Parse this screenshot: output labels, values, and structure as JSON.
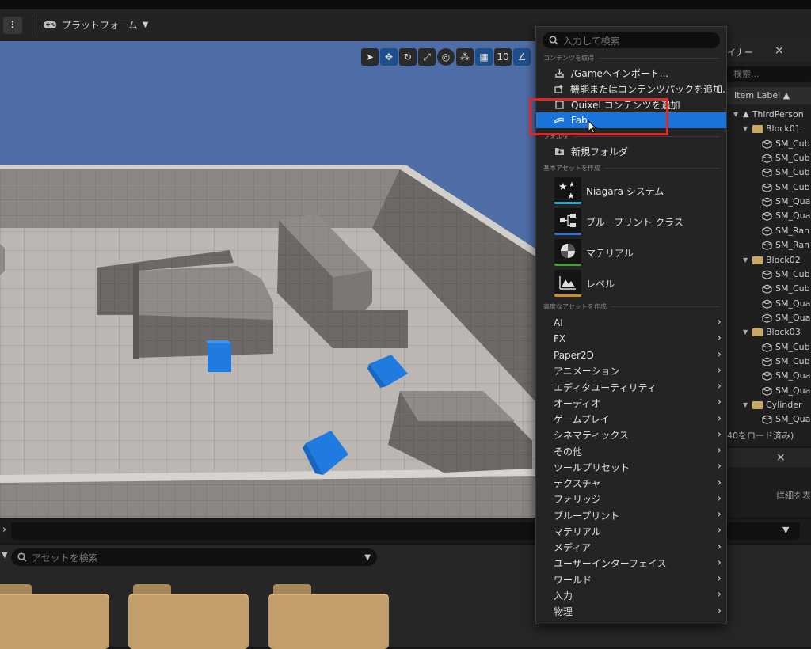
{
  "toolbar": {
    "platform_label": "プラットフォーム",
    "kebab": "⋮"
  },
  "viewport": {
    "grid_value": "10"
  },
  "outliner": {
    "tab_label": "イナー",
    "close": "×",
    "search_placeholder": "検索...",
    "column_header": "Item Label ▲",
    "rows": [
      {
        "label": "ThirdPerson",
        "kind": "level",
        "depth": 0
      },
      {
        "label": "Block01",
        "kind": "folder",
        "depth": 1
      },
      {
        "label": "SM_Cub",
        "kind": "mesh",
        "depth": 2
      },
      {
        "label": "SM_Cub",
        "kind": "mesh",
        "depth": 2
      },
      {
        "label": "SM_Cub",
        "kind": "mesh",
        "depth": 2
      },
      {
        "label": "SM_Cub",
        "kind": "mesh",
        "depth": 2
      },
      {
        "label": "SM_Qua",
        "kind": "mesh",
        "depth": 2
      },
      {
        "label": "SM_Qua",
        "kind": "mesh",
        "depth": 2
      },
      {
        "label": "SM_Ran",
        "kind": "mesh",
        "depth": 2
      },
      {
        "label": "SM_Ran",
        "kind": "mesh",
        "depth": 2
      },
      {
        "label": "Block02",
        "kind": "folder",
        "depth": 1
      },
      {
        "label": "SM_Cub",
        "kind": "mesh",
        "depth": 2
      },
      {
        "label": "SM_Cub",
        "kind": "mesh",
        "depth": 2
      },
      {
        "label": "SM_Qua",
        "kind": "mesh",
        "depth": 2
      },
      {
        "label": "SM_Qua",
        "kind": "mesh",
        "depth": 2
      },
      {
        "label": "Block03",
        "kind": "folder",
        "depth": 1
      },
      {
        "label": "SM_Cub",
        "kind": "mesh",
        "depth": 2
      },
      {
        "label": "SM_Cub",
        "kind": "mesh",
        "depth": 2
      },
      {
        "label": "SM_Qua",
        "kind": "mesh",
        "depth": 2
      },
      {
        "label": "SM_Qua",
        "kind": "mesh",
        "depth": 2
      },
      {
        "label": "Cylinder",
        "kind": "folder",
        "depth": 1
      },
      {
        "label": "SM_Qua",
        "kind": "mesh",
        "depth": 2
      }
    ],
    "status": "40をロード済み)"
  },
  "details": {
    "close": "×",
    "hint": "詳細を表示"
  },
  "content_browser": {
    "search_placeholder": "アセットを検索"
  },
  "menu": {
    "search_placeholder": "入力して検索",
    "sections": {
      "get_content": "コンテンツを取得",
      "folder": "フォルダ",
      "basic_assets": "基本アセットを作成",
      "advanced_assets": "高度なアセットを作成"
    },
    "get_content_items": [
      {
        "label": "/Gameへインポート...",
        "icon": "import-icon"
      },
      {
        "label": "機能またはコンテンツパックを追加...",
        "icon": "content-pack-icon"
      },
      {
        "label": "Quixel コンテンツを追加",
        "icon": "quixel-icon"
      },
      {
        "label": "Fab",
        "icon": "fab-icon"
      }
    ],
    "folder_item": "新規フォルダ",
    "basic_items": [
      {
        "label": "Niagara システム",
        "accent": "#2aa5c9"
      },
      {
        "label": "ブループリント クラス",
        "accent": "#3a6fd1"
      },
      {
        "label": "マテリアル",
        "accent": "#4a9a3a"
      },
      {
        "label": "レベル",
        "accent": "#d08a2a"
      }
    ],
    "advanced_items": [
      "AI",
      "FX",
      "Paper2D",
      "アニメーション",
      "エディタユーティリティ",
      "オーディオ",
      "ゲームプレイ",
      "シネマティックス",
      "その他",
      "ツールプリセット",
      "テクスチャ",
      "フォリッジ",
      "ブループリント",
      "マテリアル",
      "メディア",
      "ユーザーインターフェイス",
      "ワールド",
      "入力",
      "物理"
    ],
    "highlight_color": "#1a73d8"
  }
}
